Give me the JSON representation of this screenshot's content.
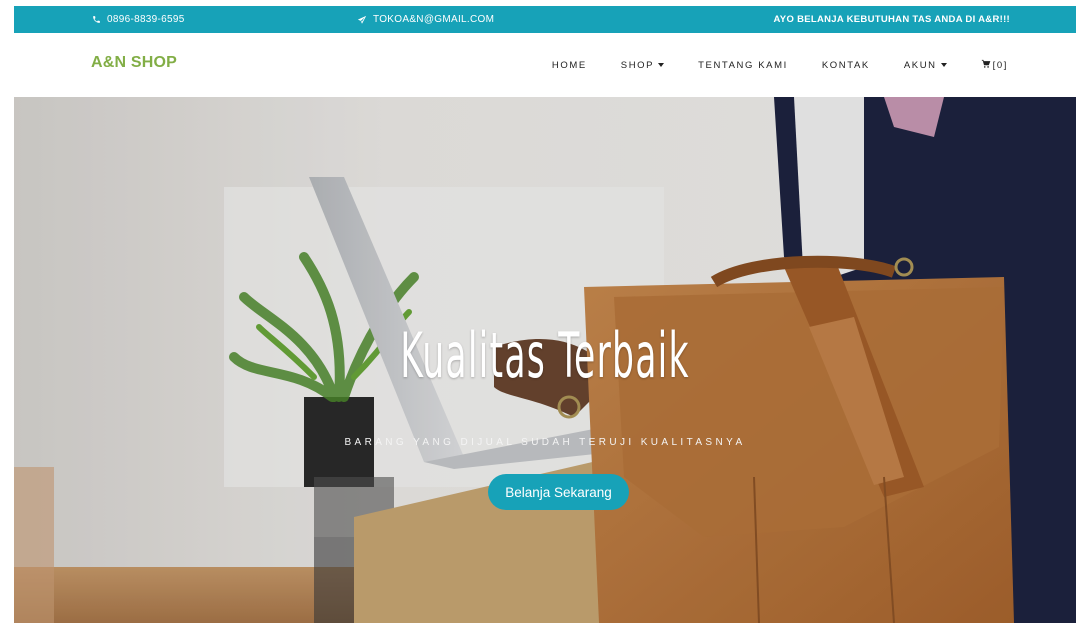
{
  "topbar": {
    "phone": "0896-8839-6595",
    "email": "TOKOA&N@GMAIL.COM",
    "promo": "AYO BELANJA KEBUTUHAN TAS ANDA DI A&R!!!",
    "icons": {
      "phone": "phone-icon",
      "email": "paper-plane-icon"
    }
  },
  "nav": {
    "brand": "A&N SHOP",
    "items": [
      {
        "label": "HOME"
      },
      {
        "label": "SHOP",
        "dropdown": true
      },
      {
        "label": "TENTANG KAMI"
      },
      {
        "label": "KONTAK"
      },
      {
        "label": "AKUN",
        "dropdown": true
      }
    ],
    "cart": {
      "icon": "cart-icon",
      "count": "[0]"
    }
  },
  "hero": {
    "title": "Kualitas Terbaik",
    "subtitle": "BARANG YANG DIJUAL SUDAH TERUJI KUALITASNYA",
    "button": "Belanja Sekarang"
  },
  "colors": {
    "accent": "#17a2b8",
    "brand": "#82ae46"
  }
}
